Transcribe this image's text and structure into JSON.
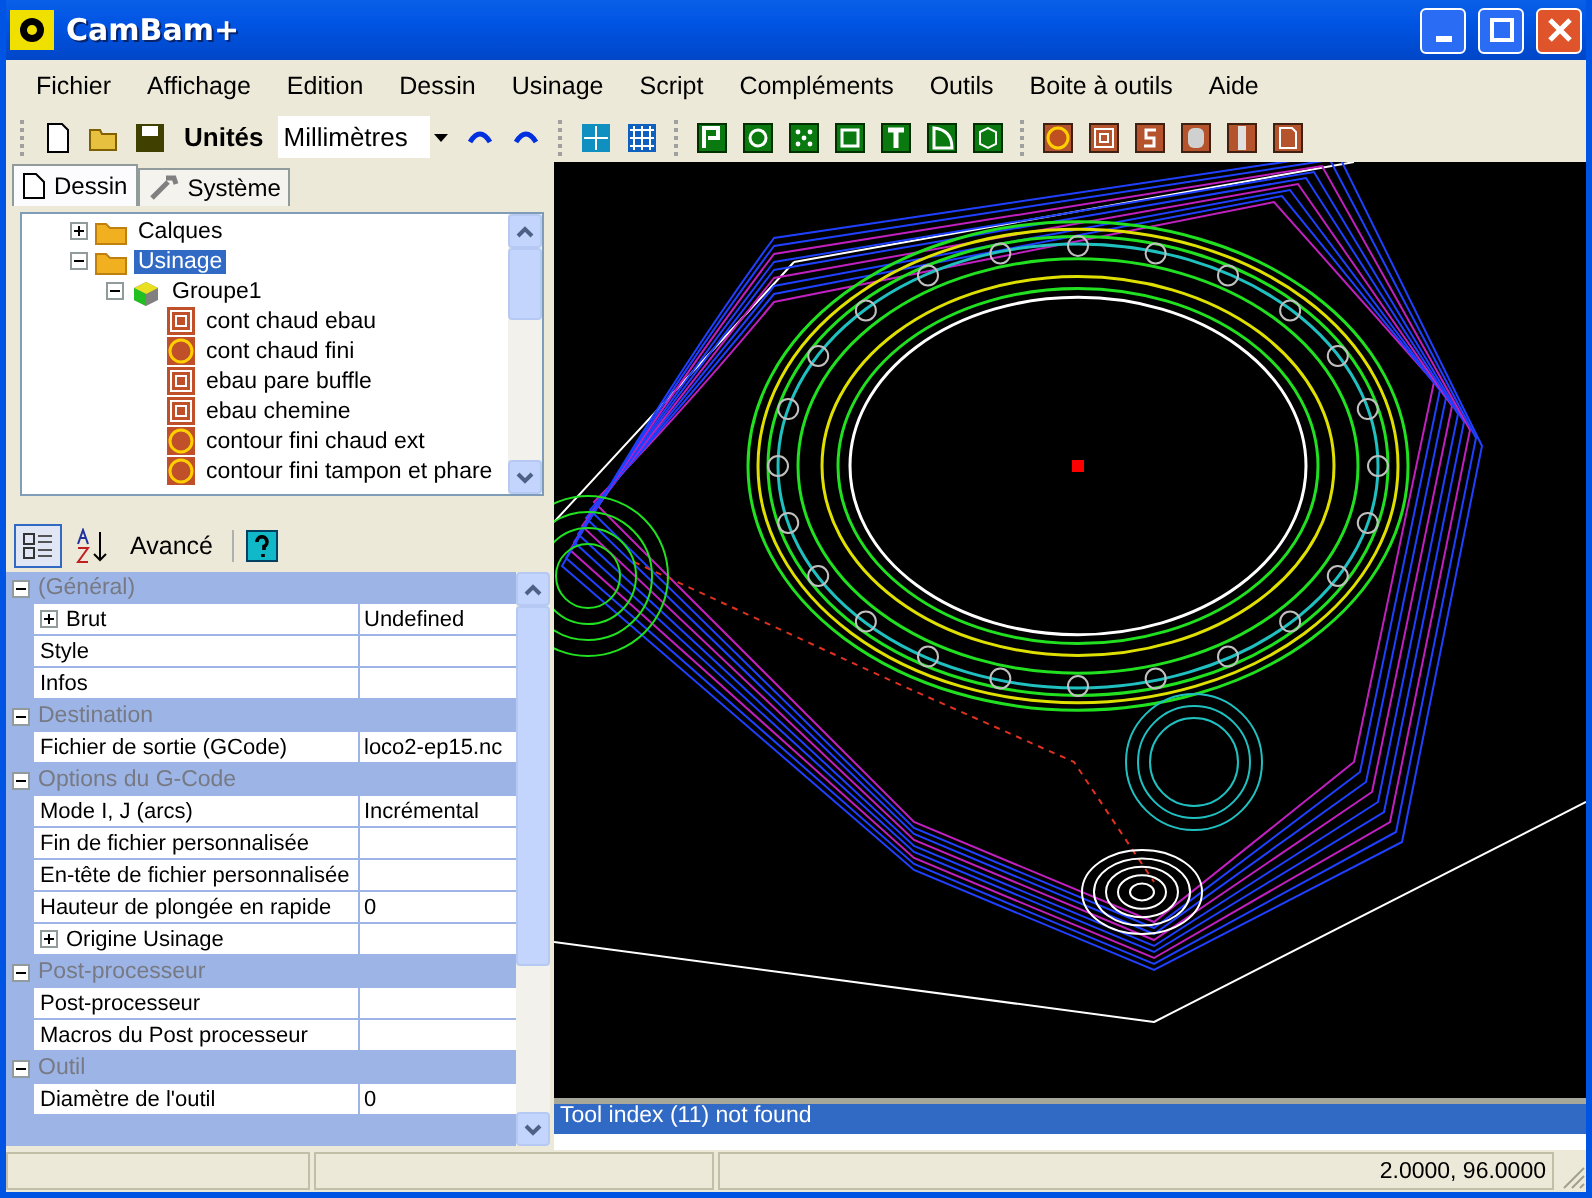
{
  "window": {
    "title": "CamBam+"
  },
  "menu": [
    "Fichier",
    "Affichage",
    "Edition",
    "Dessin",
    "Usinage",
    "Script",
    "Compléments",
    "Outils",
    "Boite à outils",
    "Aide"
  ],
  "toolbar": {
    "units_label": "Unités",
    "units_value": "Millimètres"
  },
  "tabs": [
    {
      "label": "Dessin",
      "selected": true
    },
    {
      "label": "Système",
      "selected": false
    }
  ],
  "tree": [
    {
      "label": "Calques",
      "kind": "folder",
      "expanded": false,
      "selected": false
    },
    {
      "label": "Usinage",
      "kind": "folder",
      "expanded": true,
      "selected": true,
      "children": [
        {
          "label": "Groupe1",
          "kind": "group",
          "expanded": true,
          "selected": false,
          "children": [
            {
              "label": "cont chaud ebau",
              "kind": "pocket",
              "selected": false
            },
            {
              "label": "cont chaud fini",
              "kind": "profile",
              "selected": false
            },
            {
              "label": "ebau pare buffle",
              "kind": "pocket",
              "selected": false
            },
            {
              "label": "ebau chemine",
              "kind": "pocket",
              "selected": false
            },
            {
              "label": "contour fini chaud ext",
              "kind": "profile",
              "selected": false
            },
            {
              "label": "contour fini tampon et phare",
              "kind": "profile",
              "selected": false
            }
          ]
        }
      ]
    }
  ],
  "properties_toolbar": {
    "categorized_selected": true,
    "advanced_label": "Avancé"
  },
  "properties": [
    {
      "category": "(Général)",
      "expanded": true,
      "rows": [
        {
          "name": "Brut",
          "value": "Undefined",
          "expanded": false
        },
        {
          "name": "Style",
          "value": ""
        },
        {
          "name": "Infos",
          "value": ""
        }
      ]
    },
    {
      "category": "Destination",
      "expanded": true,
      "rows": [
        {
          "name": "Fichier de sortie (GCode)",
          "value": "loco2-ep15.nc"
        }
      ]
    },
    {
      "category": "Options du G-Code",
      "expanded": true,
      "rows": [
        {
          "name": "Mode I, J (arcs)",
          "value": "Incrémental"
        },
        {
          "name": "Fin de fichier personnalisée",
          "value": ""
        },
        {
          "name": "En-tête de fichier personnalisée",
          "value": ""
        },
        {
          "name": "Hauteur de plongée en rapide",
          "value": "0"
        },
        {
          "name": "Origine Usinage",
          "value": "",
          "expanded": false
        }
      ]
    },
    {
      "category": "Post-processeur",
      "expanded": true,
      "rows": [
        {
          "name": "Post-processeur",
          "value": ""
        },
        {
          "name": "Macros du Post processeur",
          "value": ""
        }
      ]
    },
    {
      "category": "Outil",
      "expanded": true,
      "rows": [
        {
          "name": "Diamètre de l'outil",
          "value": "0"
        }
      ]
    }
  ],
  "log": [
    {
      "text": "Tool index (11) not found",
      "selected": true
    }
  ],
  "status_bar": {
    "coordinates": "2.0000, 96.0000"
  }
}
